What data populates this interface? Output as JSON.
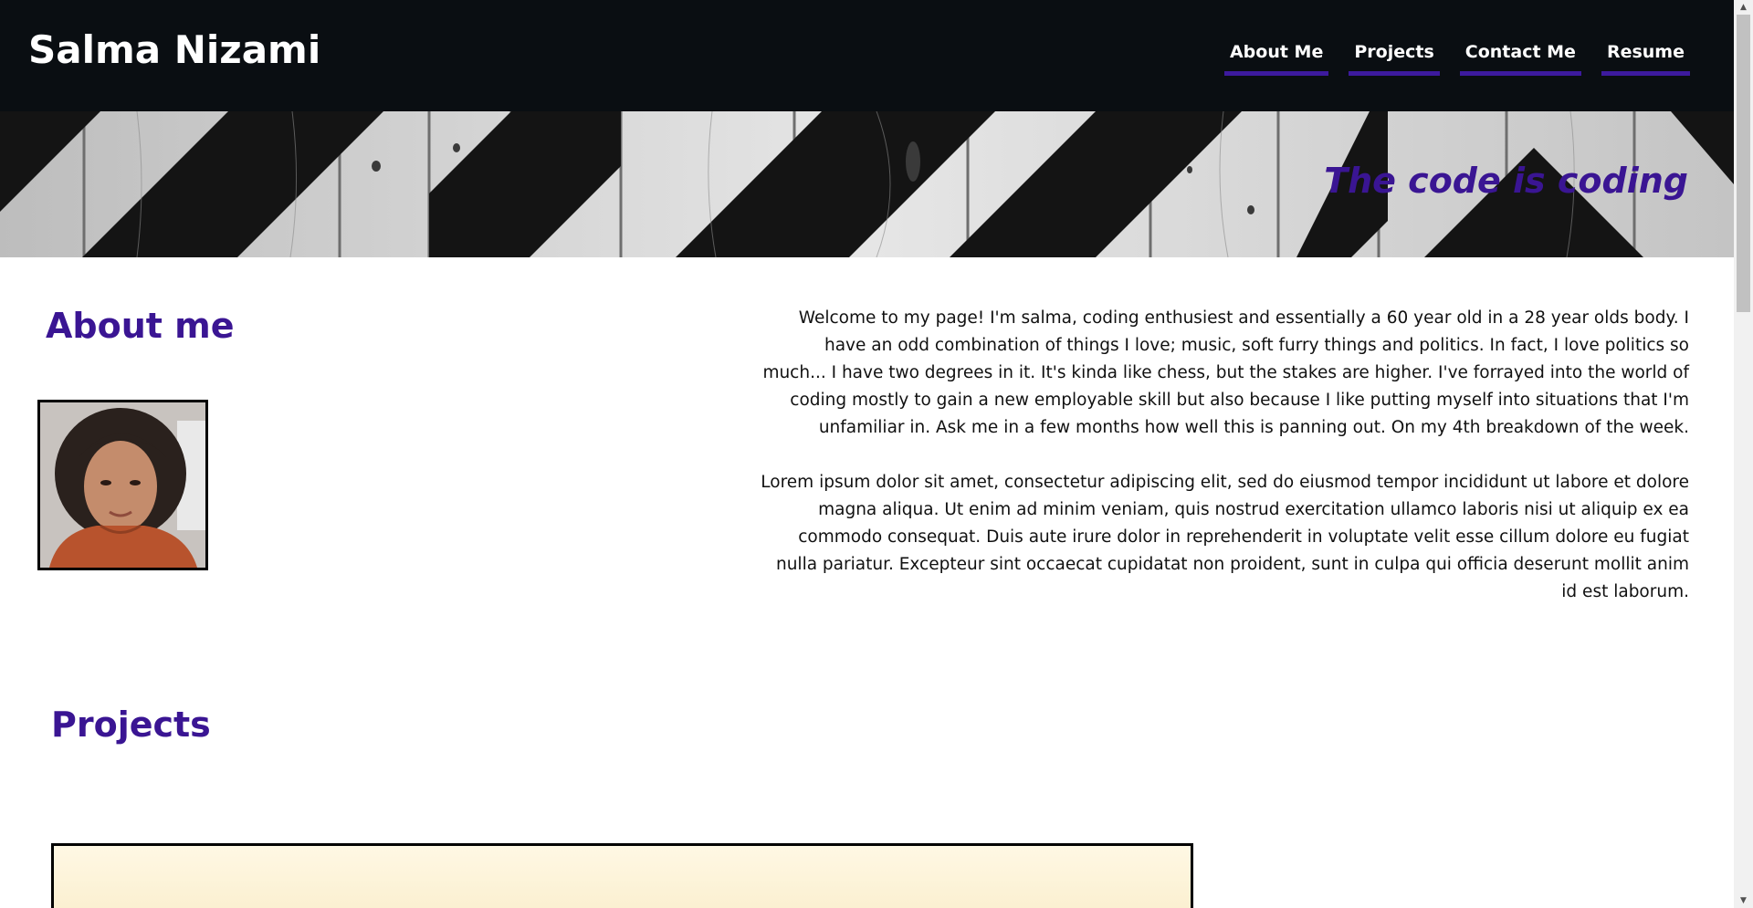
{
  "site": {
    "title": "Salma Nizami"
  },
  "nav": {
    "items": [
      {
        "label": "About Me"
      },
      {
        "label": "Projects"
      },
      {
        "label": "Contact Me"
      },
      {
        "label": "Resume"
      }
    ]
  },
  "hero": {
    "tagline": "The code is coding"
  },
  "about": {
    "heading": "About me",
    "paragraph_1": "Welcome to my page! I'm salma, coding enthusiest and essentially a 60 year old in a 28 year olds body. I have an odd combination of things I love; music, soft furry things and politics. In fact, I love politics so much... I have two degrees in it. It's kinda like chess, but the stakes are higher. I've forrayed into the world of coding mostly to gain a new employable skill but also because I like putting myself into situations that I'm unfamiliar in. Ask me in a few months how well this is panning out. On my 4th breakdown of the week.",
    "paragraph_2": "Lorem ipsum dolor sit amet, consectetur adipiscing elit, sed do eiusmod tempor incididunt ut labore et dolore magna aliqua. Ut enim ad minim veniam, quis nostrud exercitation ullamco laboris nisi ut aliquip ex ea commodo consequat. Duis aute irure dolor in reprehenderit in voluptate velit esse cillum dolore eu fugiat nulla pariatur. Excepteur sint occaecat cupidatat non proident, sunt in culpa qui officia deserunt mollit anim id est laborum."
  },
  "projects": {
    "heading": "Projects"
  },
  "colors": {
    "header_bg": "#0a0e12",
    "accent": "#3a1593",
    "nav_underline": "#3d1a9e",
    "text": "#111111"
  },
  "icons": {
    "scroll_up": "scroll-up-arrow-icon",
    "scroll_down": "scroll-down-arrow-icon"
  }
}
